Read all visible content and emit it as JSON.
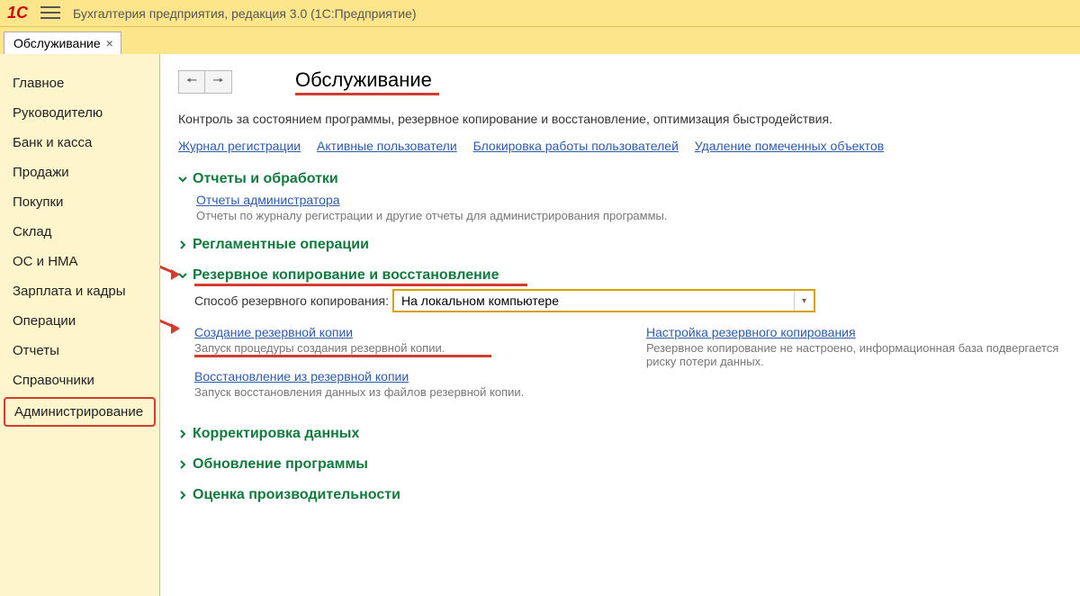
{
  "app": {
    "logo_text": "1C",
    "title": "Бухгалтерия предприятия, редакция 3.0  (1С:Предприятие)"
  },
  "tab": {
    "label": "Обслуживание"
  },
  "sidebar": {
    "items": [
      "Главное",
      "Руководителю",
      "Банк и касса",
      "Продажи",
      "Покупки",
      "Склад",
      "ОС и НМА",
      "Зарплата и кадры",
      "Операции",
      "Отчеты",
      "Справочники",
      "Администрирование"
    ]
  },
  "page": {
    "title": "Обслуживание",
    "subtitle": "Контроль за состоянием программы, резервное копирование и восстановление, оптимизация быстродействия.",
    "toplinks": [
      "Журнал регистрации",
      "Активные пользователи",
      "Блокировка работы пользователей",
      "Удаление помеченных объектов"
    ]
  },
  "sections": {
    "reports": {
      "title": "Отчеты и обработки",
      "link": "Отчеты администратора",
      "desc": "Отчеты по журналу регистрации и другие отчеты для администрирования программы."
    },
    "scheduled": {
      "title": "Регламентные операции"
    },
    "backup": {
      "title": "Резервное копирование и восстановление",
      "method_label": "Способ резервного копирования:",
      "method_value": "На локальном компьютере",
      "create_link": "Создание резервной копии",
      "create_desc": "Запуск процедуры создания резервной копии.",
      "restore_link": "Восстановление из резервной копии",
      "restore_desc": "Запуск восстановления данных из файлов резервной копии.",
      "settings_link": "Настройка резервного копирования",
      "settings_desc": "Резервное копирование не настроено, информационная база подвергается риску потери данных."
    },
    "correction": {
      "title": "Корректировка данных"
    },
    "update": {
      "title": "Обновление программы"
    },
    "perf": {
      "title": "Оценка производительности"
    }
  }
}
